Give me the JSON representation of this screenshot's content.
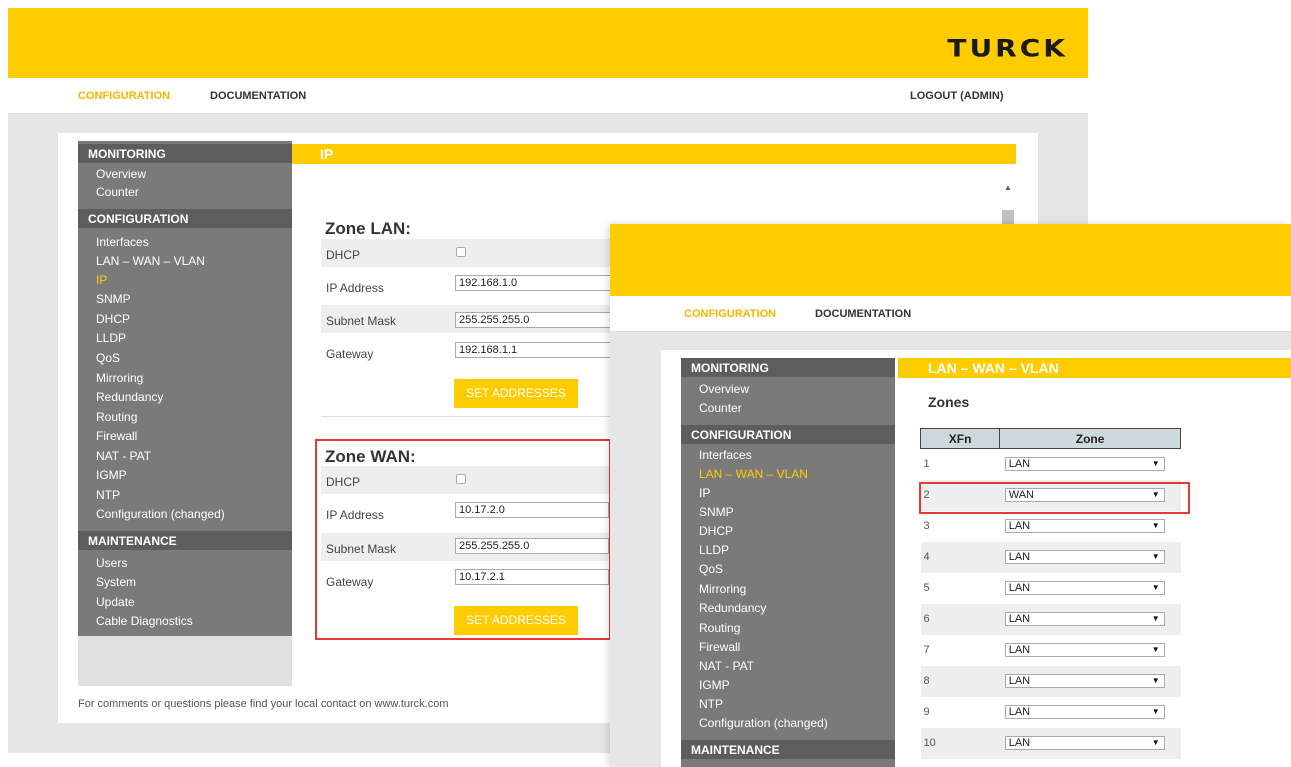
{
  "brand": {
    "logo_text": "TURCK",
    "accent": "#ffcc00",
    "sidebar_bg": "#7a7a7a"
  },
  "nav": {
    "configuration": "CONFIGURATION",
    "documentation": "DOCUMENTATION",
    "logout": "LOGOUT (ADMIN)"
  },
  "sidebar": {
    "monitoring_head": "MONITORING",
    "monitoring": [
      "Overview",
      "Counter"
    ],
    "configuration_head": "CONFIGURATION",
    "configuration": [
      "Interfaces",
      "LAN – WAN – VLAN",
      "IP",
      "SNMP",
      "DHCP",
      "LLDP",
      "QoS",
      "Mirroring",
      "Redundancy",
      "Routing",
      "Firewall",
      "NAT - PAT",
      "IGMP",
      "NTP",
      "Configuration (changed)"
    ],
    "maintenance_head": "MAINTENANCE",
    "maintenance": [
      "Users",
      "System",
      "Update",
      "Cable Diagnostics"
    ]
  },
  "ip_page": {
    "title": "IP",
    "zone_lan": {
      "title": "Zone LAN:",
      "dhcp_label": "DHCP",
      "ip_label": "IP Address",
      "ip_value": "192.168.1.0",
      "mask_label": "Subnet Mask",
      "mask_value": "255.255.255.0",
      "gateway_label": "Gateway",
      "gateway_value": "192.168.1.1",
      "button": "SET ADDRESSES"
    },
    "zone_wan": {
      "title": "Zone WAN:",
      "dhcp_label": "DHCP",
      "ip_label": "IP Address",
      "ip_value": "10.17.2.0",
      "mask_label": "Subnet Mask",
      "mask_value": "255.255.255.0",
      "gateway_label": "Gateway",
      "gateway_value": "10.17.2.1",
      "button": "SET ADDRESSES"
    },
    "footer": "For comments or questions please find your local contact on www.turck.com"
  },
  "vlan_page": {
    "title": "LAN – WAN – VLAN",
    "zones_heading": "Zones",
    "col_xfn": "XFn",
    "col_zone": "Zone",
    "rows": [
      {
        "xfn": "1",
        "zone": "LAN"
      },
      {
        "xfn": "2",
        "zone": "WAN"
      },
      {
        "xfn": "3",
        "zone": "LAN"
      },
      {
        "xfn": "4",
        "zone": "LAN"
      },
      {
        "xfn": "5",
        "zone": "LAN"
      },
      {
        "xfn": "6",
        "zone": "LAN"
      },
      {
        "xfn": "7",
        "zone": "LAN"
      },
      {
        "xfn": "8",
        "zone": "LAN"
      },
      {
        "xfn": "9",
        "zone": "LAN"
      },
      {
        "xfn": "10",
        "zone": "LAN"
      }
    ]
  }
}
